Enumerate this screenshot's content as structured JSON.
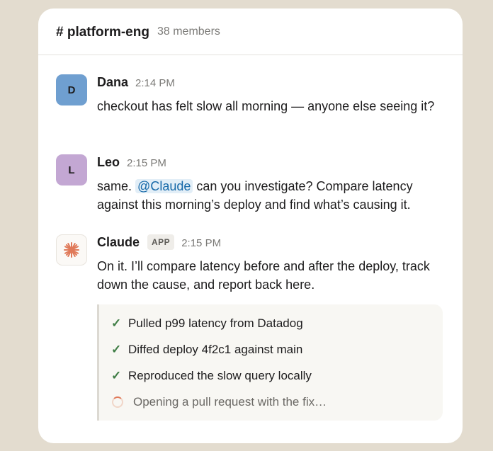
{
  "channel": {
    "hash": "#",
    "name": "platform-eng",
    "members": "38 members"
  },
  "messages": [
    {
      "avatar_initial": "D",
      "author": "Dana",
      "time": "2:14 PM",
      "text": "checkout has felt slow all morning — anyone else seeing it?"
    },
    {
      "avatar_initial": "L",
      "author": "Leo",
      "time": "2:15 PM",
      "text_before": "same.",
      "mention": "@Claude",
      "text_after": "can you investigate? Compare latency against this morning’s deploy and find what’s causing it."
    },
    {
      "avatar_icon": "claude-spark-icon",
      "author": "Claude",
      "badge": "APP",
      "time": "2:15 PM",
      "text": "On it. I’ll compare latency before and after the deploy, track down the cause, and report back here.",
      "tasks": [
        {
          "label": "Pulled p99 latency from Datadog",
          "status": "done",
          "icon": "checkmark-icon"
        },
        {
          "label": "Diffed deploy 4f2c1 against main",
          "status": "done",
          "icon": "checkmark-icon"
        },
        {
          "label": "Reproduced the slow query locally",
          "status": "done",
          "icon": "checkmark-icon"
        },
        {
          "label": "Opening a pull request with the fix…",
          "status": "in-progress",
          "icon": "spinner-icon"
        }
      ]
    }
  ],
  "colors": {
    "background": "#e3dccf",
    "dana_avatar": "#6f9fd0",
    "leo_avatar": "#c3a7d3",
    "claude_accent": "#e07a5a",
    "check_green": "#3f7d45",
    "mention_blue": "#1568a8"
  }
}
